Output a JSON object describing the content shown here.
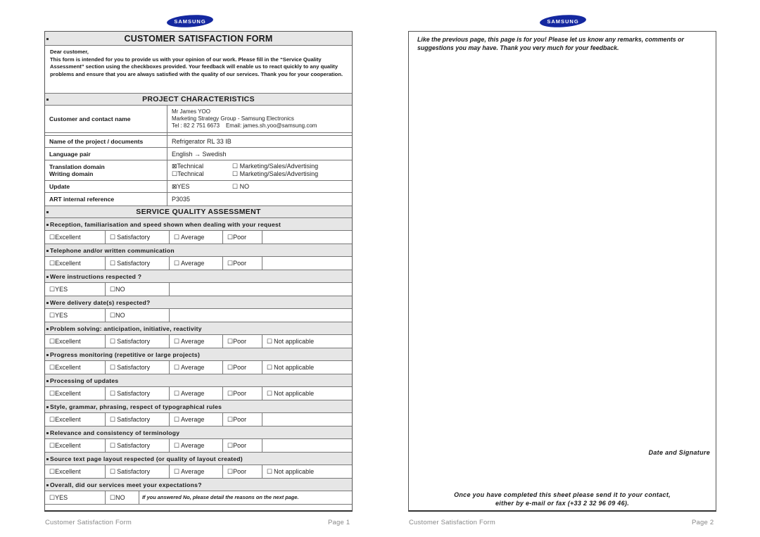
{
  "brand": {
    "logo_text": "SAMSUNG",
    "logo_color": "#1428a0"
  },
  "page1": {
    "title": "CUSTOMER SATISFACTION FORM",
    "intro_greeting": "Dear customer,",
    "intro_text": "This form is intended for you to provide us with your opinion of our work. Please fill in the “Service Quality Assessment” section using the checkboxes provided. Your feedback will enable us to react quickly to any quality problems and ensure that you are always satisfied with the quality of our services. Thank you for your cooperation.",
    "project": {
      "heading": "PROJECT CHARACTERISTICS",
      "customer_label": "Customer and contact name",
      "customer_name": "Mr James YOO",
      "customer_group": "Marketing Strategy Group - Samsung Electronics",
      "customer_contact": "Tel : 82 2 751 6673    Email: james.sh.yoo@samsung.com",
      "project_label": "Name of the project / documents",
      "project_value": "Refrigerator RL 33 IB",
      "language_label": "Language pair",
      "language_value": "English → Swedish",
      "translation_label": "Translation domain",
      "writing_label": "Writing domain",
      "translation_opts": [
        {
          "label": "Technical",
          "checked": true,
          "mark": "⊠"
        },
        {
          "label": "Marketing/Sales/Advertising",
          "checked": false,
          "mark": "☐"
        }
      ],
      "writing_opts": [
        {
          "label": "Technical",
          "checked": false,
          "mark": "☐"
        },
        {
          "label": "Marketing/Sales/Advertising",
          "checked": false,
          "mark": "☐"
        }
      ],
      "update_label": "Update",
      "update_opts": [
        {
          "label": "YES",
          "checked": true,
          "mark": "⊠"
        },
        {
          "label": "NO",
          "checked": false,
          "mark": "☐"
        }
      ],
      "art_label": "ART internal reference",
      "art_value": "P3035"
    },
    "assessment": {
      "heading": "SERVICE QUALITY ASSESSMENT",
      "checkbox_mark": "☐",
      "questions": [
        {
          "q": "Reception, familiarisation and speed shown when dealing with your request",
          "opts": [
            "Excellent",
            "Satisfactory",
            "Average",
            "Poor"
          ]
        },
        {
          "q": "Telephone and/or written communication",
          "opts": [
            "Excellent",
            "Satisfactory",
            "Average",
            "Poor"
          ]
        },
        {
          "q": "Were instructions respected ?",
          "opts": [
            "YES",
            "NO"
          ]
        },
        {
          "q": "Were delivery date(s) respected?",
          "opts": [
            "YES",
            "NO"
          ]
        },
        {
          "q": "Problem solving: anticipation, initiative, reactivity",
          "opts": [
            "Excellent",
            "Satisfactory",
            "Average",
            "Poor",
            "Not applicable"
          ]
        },
        {
          "q": "Progress monitoring (repetitive or large projects)",
          "opts": [
            "Excellent",
            "Satisfactory",
            "Average",
            "Poor",
            "Not applicable"
          ]
        },
        {
          "q": "Processing of updates",
          "opts": [
            "Excellent",
            "Satisfactory",
            "Average",
            "Poor",
            "Not applicable"
          ]
        },
        {
          "q": "Style, grammar, phrasing, respect of typographical rules",
          "opts": [
            "Excellent",
            "Satisfactory",
            "Average",
            "Poor"
          ]
        },
        {
          "q": "Relevance and consistency of terminology",
          "opts": [
            "Excellent",
            "Satisfactory",
            "Average",
            "Poor"
          ]
        },
        {
          "q": "Source text page layout respected (or quality of layout created)",
          "opts": [
            "Excellent",
            "Satisfactory",
            "Average",
            "Poor",
            "Not applicable"
          ]
        },
        {
          "q": "Overall, did our services meet your expectations?",
          "opts": [
            "YES",
            "NO"
          ],
          "note": "If you answered No, please detail the reasons on the next page."
        }
      ]
    },
    "footer_left": "Customer Satisfaction Form",
    "footer_right": "Page 1"
  },
  "page2": {
    "intro": "Like the previous page, this page is for you! Please let us know any remarks, comments or suggestions you may have. Thank you very much for your feedback.",
    "signature_label": "Date and Signature",
    "send_line1": "Once you have completed this sheet please send it to your contact,",
    "send_line2": "either by e-mail or fax (+33 2 32 96 09 46).",
    "footer_left": "Customer Satisfaction Form",
    "footer_right": "Page 2"
  }
}
